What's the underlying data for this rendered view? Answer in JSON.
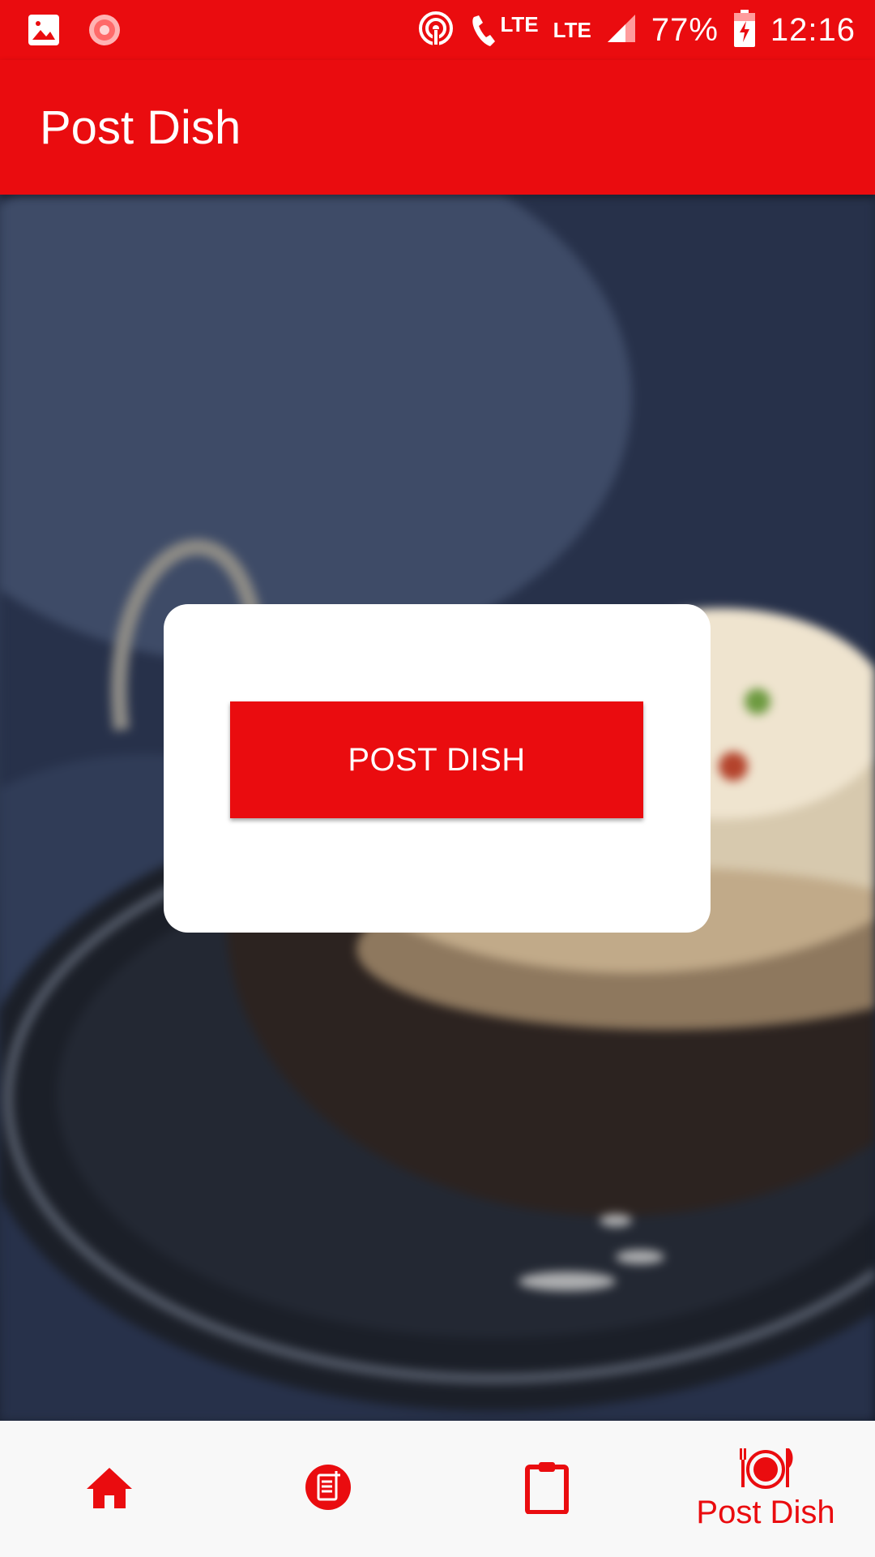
{
  "status_bar": {
    "lte1": "LTE",
    "lte2": "LTE",
    "battery": "77%",
    "time": "12:16"
  },
  "toolbar": {
    "title": "Post Dish"
  },
  "card": {
    "button_label": "POST DISH"
  },
  "bottom_nav": {
    "items": [
      {
        "icon": "home-icon",
        "label": ""
      },
      {
        "icon": "menu-add-icon",
        "label": ""
      },
      {
        "icon": "clipboard-icon",
        "label": ""
      },
      {
        "icon": "dish-icon",
        "label": "Post Dish"
      }
    ]
  },
  "colors": {
    "accent": "#ea0c0f",
    "nav_background": "#f8f8f8",
    "card_background": "#ffffff"
  }
}
